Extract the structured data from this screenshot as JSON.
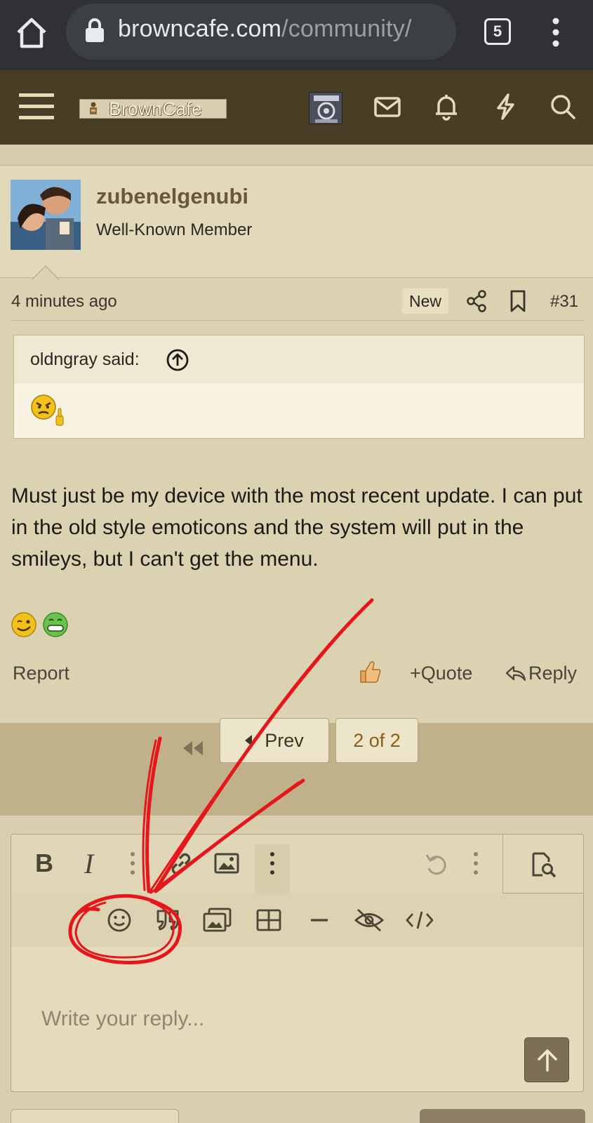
{
  "browser": {
    "url_domain": "browncafe.com",
    "url_path": "/community/",
    "tab_count": "5"
  },
  "site": {
    "logo_text": "BrownCafe"
  },
  "post": {
    "username": "zubenelgenubi",
    "user_title": "Well-Known Member",
    "time": "4 minutes ago",
    "badge": "New",
    "number": "#31",
    "quote_author": "oldngray said:",
    "body": "Must just be my device with the most recent update. I can put in the old style emoticons and the system will put in the smileys, but I can't get the menu.",
    "actions": {
      "report": "Report",
      "quote": "Quote",
      "reply": "Reply"
    }
  },
  "pagination": {
    "prev": "Prev",
    "current": "2 of 2"
  },
  "editor": {
    "bold": "B",
    "italic": "I",
    "placeholder": "Write your reply..."
  },
  "colors": {
    "header_bg": "#483d25",
    "page_bg": "#d9cfae",
    "accent_brown": "#6b5836",
    "annotation_red": "#e6161b"
  }
}
